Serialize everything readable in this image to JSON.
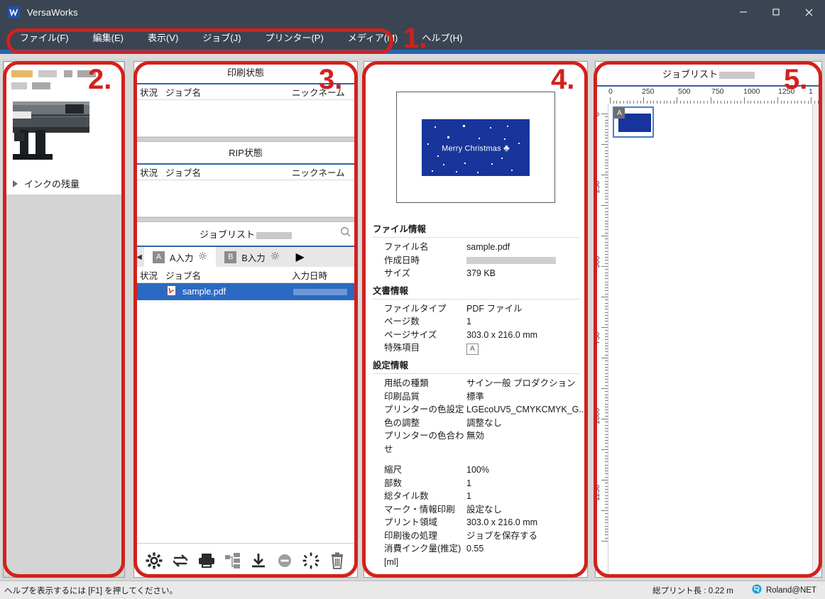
{
  "window": {
    "title": "VersaWorks",
    "app_icon": "versaworks-logo-icon",
    "minimize": "−",
    "maximize": "□",
    "close": "✕"
  },
  "menu": {
    "items": [
      {
        "label": "ファイル(F)",
        "accel": "F"
      },
      {
        "label": "編集(E)",
        "accel": "E"
      },
      {
        "label": "表示(V)",
        "accel": "V"
      },
      {
        "label": "ジョブ(J)",
        "accel": "J"
      },
      {
        "label": "プリンター(P)",
        "accel": "P"
      },
      {
        "label": "メディア(M)",
        "accel": "M"
      },
      {
        "label": "ヘルプ(H)",
        "accel": "H"
      }
    ]
  },
  "printer_panel": {
    "name_redacted": true,
    "ink_level_label": "インクの残量",
    "expander_icon": "triangle-right-icon",
    "printer_image": "printer-photo"
  },
  "status_panel": {
    "print_status": {
      "title": "印刷状態",
      "columns": [
        "状況",
        "ジョブ名",
        "ニックネーム"
      ],
      "rows": []
    },
    "rip_status": {
      "title": "RIP状態",
      "columns": [
        "状況",
        "ジョブ名",
        "ニックネーム"
      ],
      "rows": []
    },
    "job_list": {
      "title": "ジョブリスト",
      "title_redacted": true,
      "search_icon": "search-icon",
      "tabs": [
        {
          "badge": "A",
          "label": "A入力",
          "gear_icon": "gear-icon",
          "active": true
        },
        {
          "badge": "B",
          "label": "B入力",
          "gear_icon": "gear-icon",
          "active": false
        }
      ],
      "play_icon": "play-icon",
      "columns": [
        "状況",
        "ジョブ名",
        "入力日時"
      ],
      "rows": [
        {
          "status": "",
          "icon": "pdf-file-icon",
          "name": "sample.pdf",
          "date_redacted": true,
          "selected": true
        }
      ]
    },
    "toolbar": {
      "buttons": [
        {
          "icon": "gear-icon",
          "name": "settings"
        },
        {
          "icon": "refresh-loop-icon",
          "name": "rip-and-print"
        },
        {
          "icon": "printer-icon",
          "name": "print"
        },
        {
          "icon": "tile-duplicate-icon",
          "name": "nesting"
        },
        {
          "icon": "download-icon",
          "name": "save"
        },
        {
          "icon": "minus-circle-icon",
          "name": "abort"
        },
        {
          "icon": "spinner-icon",
          "name": "processing"
        },
        {
          "icon": "trash-icon",
          "name": "delete"
        }
      ]
    }
  },
  "info_panel": {
    "preview": {
      "card_text": "Merry Christmas",
      "tree_glyph": "♣",
      "card_color": "#17359b"
    },
    "file_info": {
      "title": "ファイル情報",
      "rows": [
        {
          "key": "ファイル名",
          "value": "sample.pdf"
        },
        {
          "key": "作成日時",
          "value": "",
          "redacted": true
        },
        {
          "key": "サイズ",
          "value": "379 KB"
        }
      ]
    },
    "document_info": {
      "title": "文書情報",
      "rows": [
        {
          "key": "ファイルタイプ",
          "value": "PDF ファイル"
        },
        {
          "key": "ページ数",
          "value": "1"
        },
        {
          "key": "ページサイズ",
          "value": "303.0 x 216.0 mm"
        },
        {
          "key": "特殊項目",
          "value": "A",
          "badge": true
        }
      ]
    },
    "settings_info": {
      "title": "設定情報",
      "rows_group1": [
        {
          "key": "用紙の種類",
          "value": "サイン一般 プロダクション"
        },
        {
          "key": "印刷品質",
          "value": "標準"
        },
        {
          "key": "プリンターの色設定",
          "value": "LGEcoUV5_CMYKCMYK_G..."
        },
        {
          "key": "色の調整",
          "value": "調整なし"
        },
        {
          "key": "プリンターの色合わせ",
          "value": "無効"
        }
      ],
      "rows_group2": [
        {
          "key": "縮尺",
          "value": "100%"
        },
        {
          "key": "部数",
          "value": "1"
        },
        {
          "key": "総タイル数",
          "value": "1"
        },
        {
          "key": "マーク・情報印刷",
          "value": "設定なし"
        },
        {
          "key": "プリント領域",
          "value": "303.0 x 216.0 mm"
        },
        {
          "key": "印刷後の処理",
          "value": "ジョブを保存する"
        },
        {
          "key": "消費インク量(推定) [ml]",
          "value": "0.55"
        }
      ]
    }
  },
  "layout_panel": {
    "title": "ジョブリスト",
    "title_redacted": true,
    "ruler_h_labels": [
      "0",
      "250",
      "500",
      "750",
      "1000",
      "1250"
    ],
    "ruler_v_labels": [
      "0",
      "250",
      "500",
      "750",
      "1000",
      "1250"
    ],
    "job_thumb": {
      "badge": "A",
      "color": "#17359b"
    }
  },
  "statusbar": {
    "hint": "ヘルプを表示するには [F1] を押してください。",
    "total_print_length": "総プリント長 : 0.22 m",
    "roland_net": "Roland@NET",
    "roland_icon": "roland-net-icon"
  },
  "annotations": [
    {
      "num": "1.",
      "target": "menubar"
    },
    {
      "num": "2.",
      "target": "printer-panel"
    },
    {
      "num": "3.",
      "target": "status-panel"
    },
    {
      "num": "4.",
      "target": "info-panel"
    },
    {
      "num": "5.",
      "target": "layout-panel"
    }
  ]
}
